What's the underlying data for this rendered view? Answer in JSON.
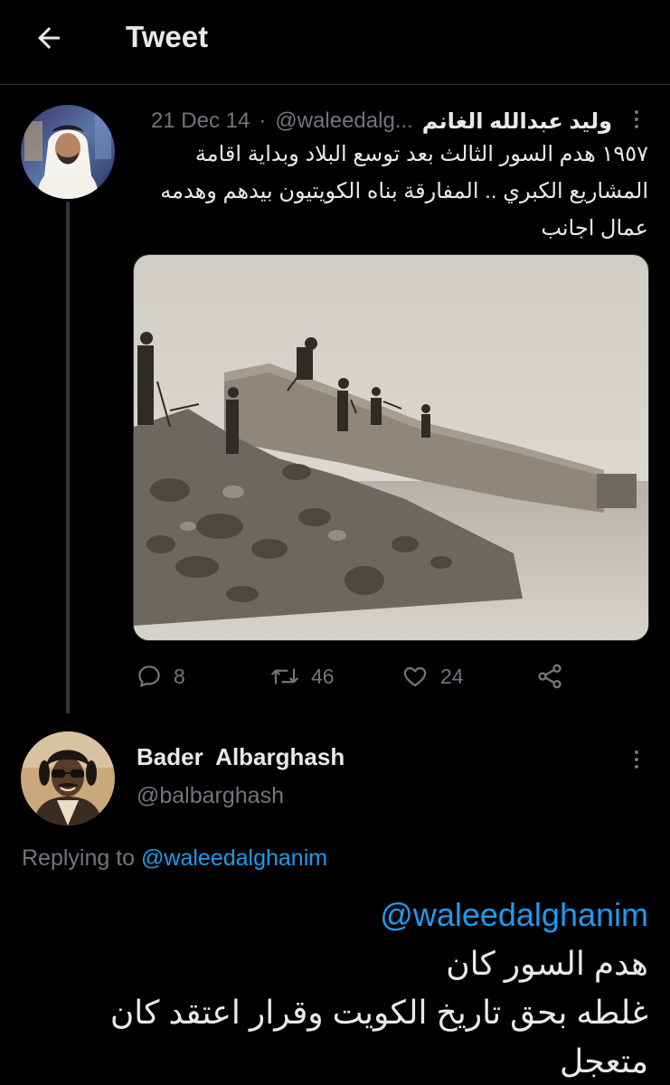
{
  "header": {
    "title": "Tweet"
  },
  "tweet": {
    "author_name": "وليد عبدالله الغانم",
    "author_handle": "@waleedalg...",
    "separator": "·",
    "date": "21 Dec 14",
    "text_lines": [
      "١٩٥٧ هدم السور الثالث بعد توسع البلاد وبداية اقامة",
      "المشاريع الكبري .. المفارقة بناه الكويتيون بيدهم وهدمه",
      "عمال اجانب"
    ],
    "stats": {
      "replies": "8",
      "retweets": "46",
      "likes": "24"
    }
  },
  "reply": {
    "author_name": "Bader  Albarghash",
    "author_handle": "@balbarghash",
    "replying_prefix": "Replying to",
    "replying_to": "@waleedalghanim",
    "mention": "@waleedalghanim",
    "text_lines": [
      "هدم السور كان",
      "غلطه بحق تاريخ الكويت وقرار اعتقد كان",
      "متعجل"
    ]
  },
  "colors": {
    "background": "#000000",
    "text": "#e7e9ea",
    "secondary": "#71767b",
    "accent": "#1d9bf0",
    "divider": "#2f3336"
  },
  "icons": [
    "back-arrow-icon",
    "more-icon",
    "reply-icon",
    "retweet-icon",
    "like-icon",
    "share-icon"
  ]
}
